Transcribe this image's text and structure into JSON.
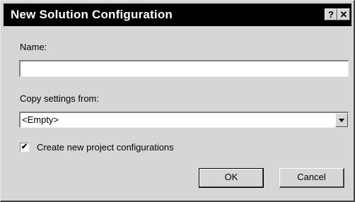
{
  "dialog": {
    "title": "New Solution Configuration",
    "help_button": "?",
    "close_button": "✕"
  },
  "name_field": {
    "label": "Name:",
    "value": ""
  },
  "copy_settings": {
    "label": "Copy settings from:",
    "selected": "<Empty>"
  },
  "create_project_configs": {
    "label": "Create new project configurations",
    "checked": true,
    "check_glyph": "✔"
  },
  "buttons": {
    "ok": "OK",
    "cancel": "Cancel"
  }
}
